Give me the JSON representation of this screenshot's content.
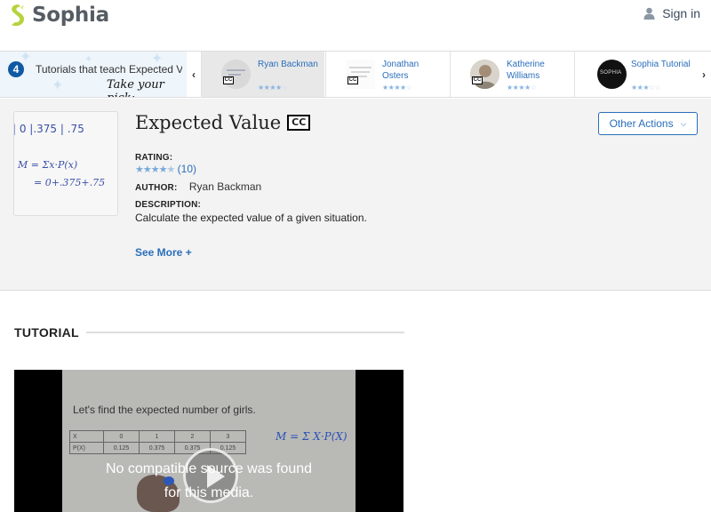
{
  "header": {
    "logo_text": "Sophia",
    "signin_label": "Sign in"
  },
  "strip": {
    "count": "4",
    "intro_text": "Tutorials that teach Expected Value",
    "pick_text": "Take your pick:",
    "tutorials": [
      {
        "name": "Ryan Backman",
        "cc": "CC",
        "rating": 4,
        "active": true
      },
      {
        "name": "Jonathan Osters",
        "cc": "CC",
        "rating": 4,
        "active": false
      },
      {
        "name": "Katherine Williams",
        "cc": "CC",
        "rating": 4,
        "active": false
      },
      {
        "name": "Sophia Tutorial",
        "thumb_text": "SOPHIA",
        "rating": 3,
        "active": false
      }
    ]
  },
  "tutorial": {
    "title": "Expected Value",
    "cc": "CC",
    "rating_label": "RATING:",
    "rating_count": "(10)",
    "rating_value": 4.5,
    "author_label": "AUTHOR:",
    "author_name": "Ryan Backman",
    "description_label": "DESCRIPTION:",
    "description": "Calculate the expected value of a given situation.",
    "see_more": "See More +",
    "other_actions": "Other Actions",
    "thumb_line1": "| 0  |.375 | .75",
    "thumb_line2": "M = Σx·P(x)",
    "thumb_line3": "= 0+.375+.75"
  },
  "section": {
    "title": "TUTORIAL"
  },
  "video": {
    "paper_text": "Let's find the expected number of girls.",
    "table_header": [
      "X",
      "0",
      "1",
      "2",
      "3"
    ],
    "table_row": [
      "P(X)",
      "0.125",
      "0.375",
      "0.375",
      "0.125"
    ],
    "formula": "M = Σ X·P(X)",
    "no_media_line1": "No compatible source was found",
    "no_media_line2": "for this media."
  },
  "colors": {
    "accent": "#2a6ebb",
    "logo_green": "#b5d33d",
    "badge": "#0f5aa3"
  }
}
